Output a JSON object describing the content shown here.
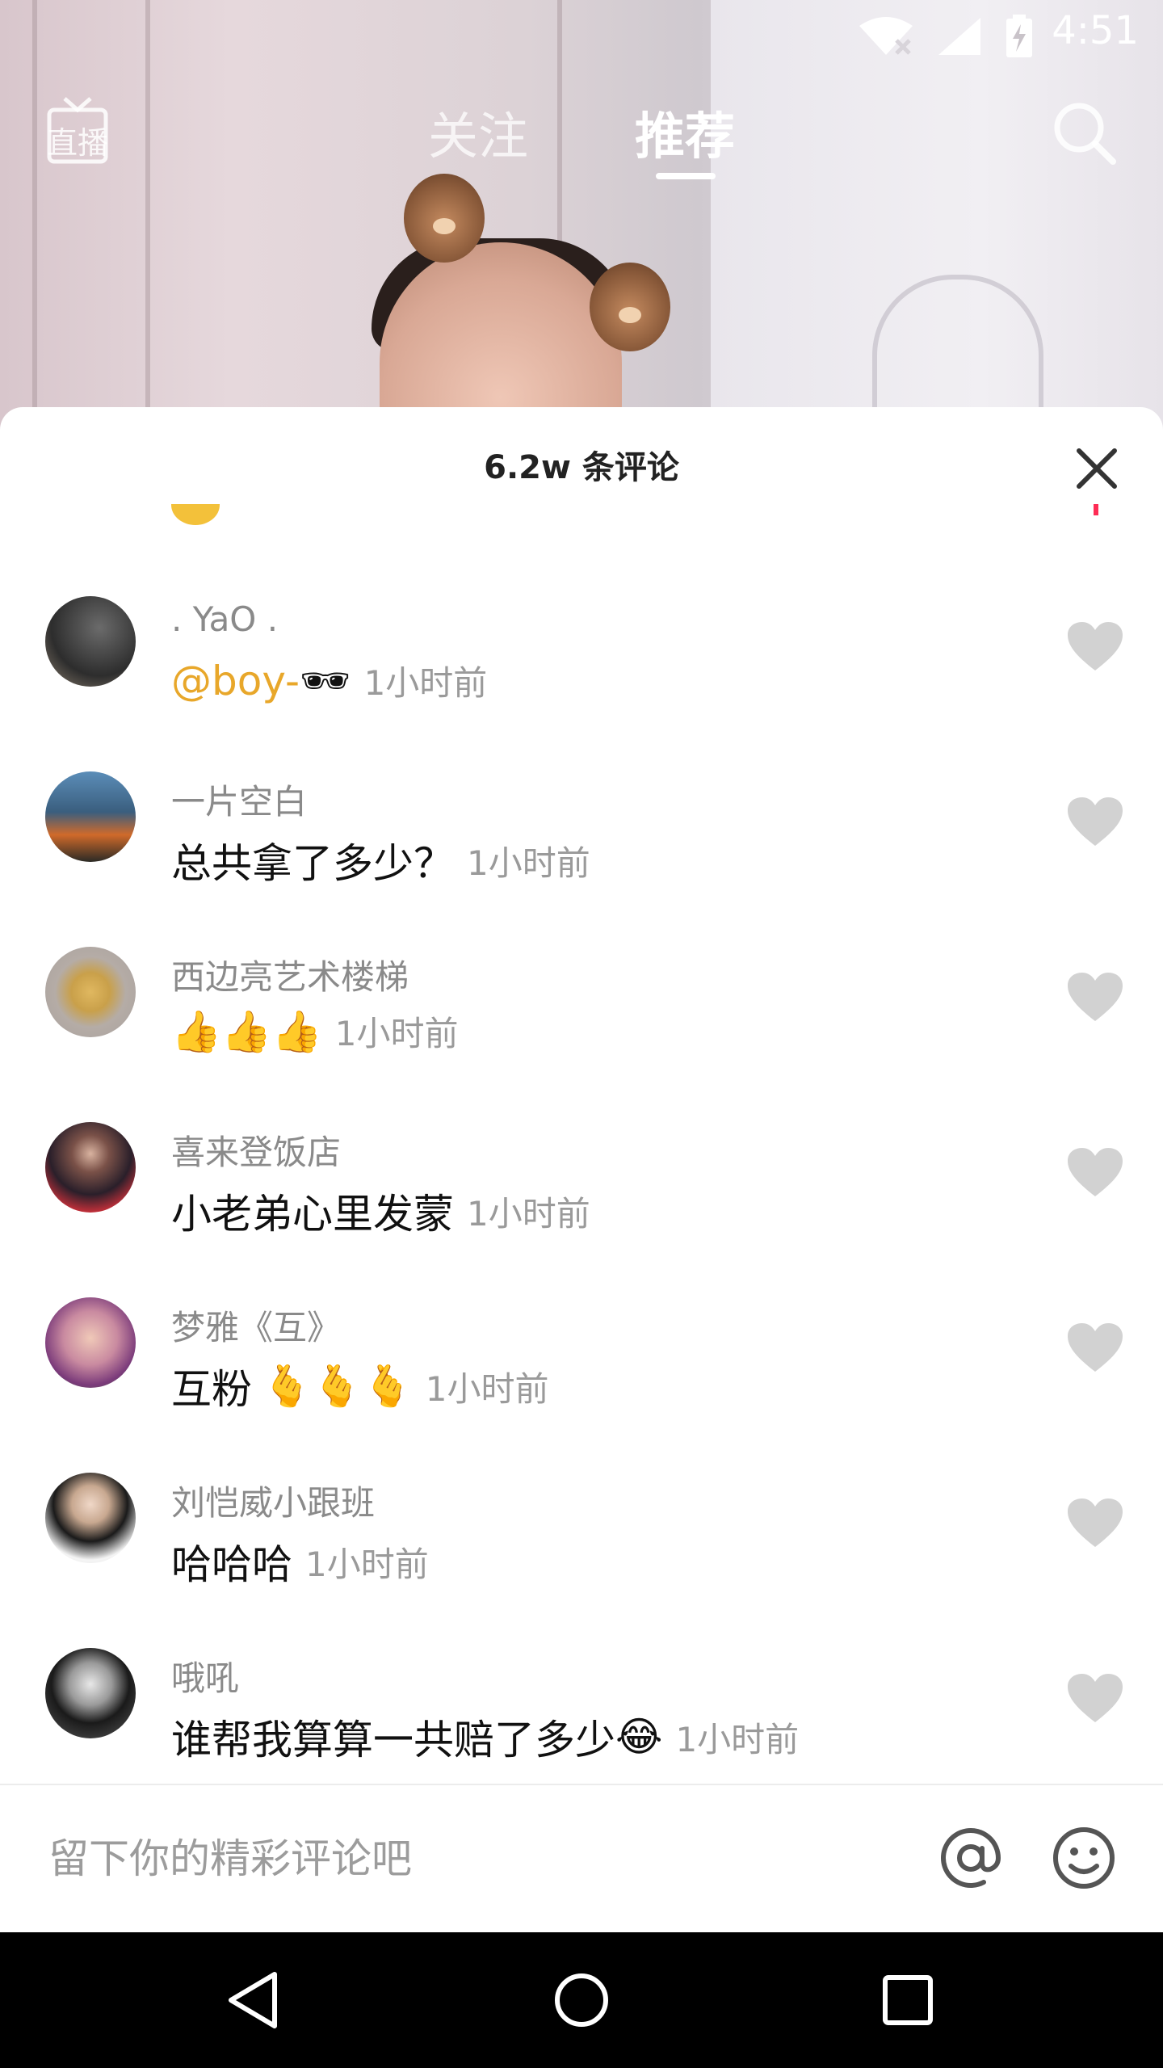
{
  "status_bar": {
    "time": "4:51"
  },
  "top_nav": {
    "live_label": "直播",
    "tabs": [
      {
        "label": "关注"
      },
      {
        "label": "推荐"
      }
    ]
  },
  "comments_sheet": {
    "title": "6.2w 条评论",
    "comments": [
      {
        "username": ". YaO .",
        "mention": "@boy-",
        "text": "",
        "emoji": "🕶",
        "time": "1小时前"
      },
      {
        "username": "一片空白",
        "text": "总共拿了多少？",
        "emoji": "",
        "time": "1小时前"
      },
      {
        "username": "西边亮艺术楼梯",
        "text": "",
        "emoji": "👍👍👍",
        "time": "1小时前"
      },
      {
        "username": "喜来登饭店",
        "text": "小老弟心里发蒙",
        "emoji": "",
        "time": "1小时前"
      },
      {
        "username": "梦雅《互》",
        "text": "互粉",
        "emoji": "🫰🫰🫰",
        "time": "1小时前"
      },
      {
        "username": "刘恺威小跟班",
        "text": "哈哈哈",
        "emoji": "",
        "time": "1小时前"
      },
      {
        "username": "哦吼",
        "text": "谁帮我算算一共赔了多少",
        "emoji": "😂",
        "time": "1小时前"
      }
    ]
  },
  "input_bar": {
    "placeholder": "留下你的精彩评论吧"
  },
  "colors": {
    "mention": "#e8a72a",
    "accent": "#fe2c55"
  }
}
